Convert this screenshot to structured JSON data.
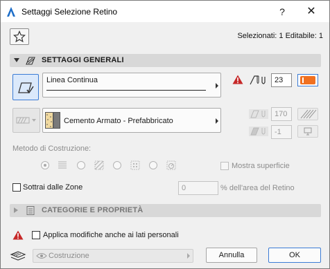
{
  "window": {
    "title": "Settaggi Selezione Retino",
    "help_label": "?",
    "close_label": "✕"
  },
  "header": {
    "selection_count": "Selezionati: 1 Editabile: 1"
  },
  "sections": {
    "general": {
      "label": "SETTAGGI GENERALI",
      "expanded": true
    },
    "categories": {
      "label": "CATEGORIE E PROPRIETÀ",
      "expanded": false
    }
  },
  "line": {
    "type_label": "Linea Continua",
    "pen_number": "23",
    "pen_color": "#f07020"
  },
  "fill": {
    "material_label": "Cemento Armato - Prefabbricato",
    "background_pen": "170",
    "foreground_pen": "-1"
  },
  "construction_method": {
    "label": "Metodo di Costruzione:",
    "options": [
      "standard-fill-icon",
      "hatch-fill-icon",
      "tile-fill-icon",
      "rotated-fill-icon"
    ],
    "show_area_label": "Mostra superficie"
  },
  "zones": {
    "subtract_label": "Sottrai dalle Zone",
    "area_value": "0",
    "area_suffix": "% dell'area del Retino"
  },
  "footer": {
    "apply_label": "Applica modifiche anche ai lati personali",
    "layer_label": "Costruzione",
    "cancel_label": "Annulla",
    "ok_label": "OK"
  },
  "colors": {
    "accent": "#3a7bd5",
    "warning": "#d32f2f",
    "pen_orange": "#f07020"
  }
}
